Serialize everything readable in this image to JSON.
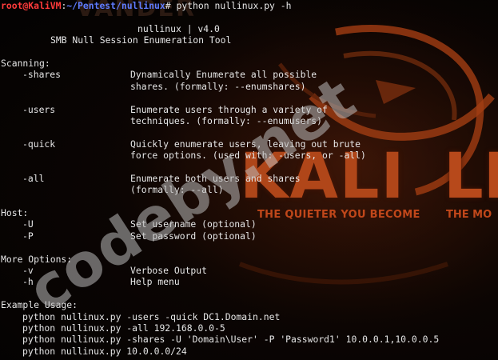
{
  "prompt": {
    "user_host": "root@KaliVM",
    "separator": ":",
    "path": "~/Pentest/nullinux",
    "symbol": "# ",
    "command": "python nullinux.py -h"
  },
  "header": {
    "version_line": "nullinux | v4.0",
    "subtitle": "SMB Null Session Enumeration Tool"
  },
  "sections": {
    "scanning": {
      "title": "Scanning:",
      "options": [
        {
          "flag": "-shares",
          "desc": [
            "Dynamically Enumerate all possible",
            "shares. (formally: --enumshares)"
          ]
        },
        {
          "flag": "-users",
          "desc": [
            "Enumerate users through a variety of",
            "techniques. (formally: --enumusers)"
          ]
        },
        {
          "flag": "-quick",
          "desc": [
            "Quickly enumerate users, leaving out brute",
            "force options. (used with: -users, or -all)"
          ]
        },
        {
          "flag": "-all",
          "desc": [
            "Enumerate both users and shares",
            "(formally: --all)"
          ]
        }
      ]
    },
    "host": {
      "title": "Host:",
      "options": [
        {
          "flag": "-U",
          "desc": "Set username (optional)"
        },
        {
          "flag": "-P",
          "desc": "Set password (optional)"
        }
      ]
    },
    "more": {
      "title": "More Options:",
      "options": [
        {
          "flag": "-v",
          "desc": "Verbose Output"
        },
        {
          "flag": "-h",
          "desc": "Help menu"
        }
      ]
    },
    "examples": {
      "title": "Example Usage:",
      "lines": [
        "python nullinux.py -users -quick DC1.Domain.net",
        "python nullinux.py -all 192.168.0.0-5",
        "python nullinux.py -shares -U 'Domain\\User' -P 'Password1' 10.0.0.1,10.0.0.5",
        "python nullinux.py 10.0.0.0/24"
      ]
    }
  },
  "wallpaper": {
    "logo_left": "KALI",
    "logo_right": "LIN",
    "tagline_left": "THE QUIETER YOU BECOME",
    "tagline_right": "THE MO",
    "brand_top": "VANDER",
    "accent_color": "#b7491b"
  },
  "watermark": {
    "text": "codeby.net"
  },
  "colors": {
    "prompt_user": "#ff3b3b",
    "prompt_path": "#5f7cff",
    "text": "#e6e6e6",
    "background": "#050505"
  }
}
